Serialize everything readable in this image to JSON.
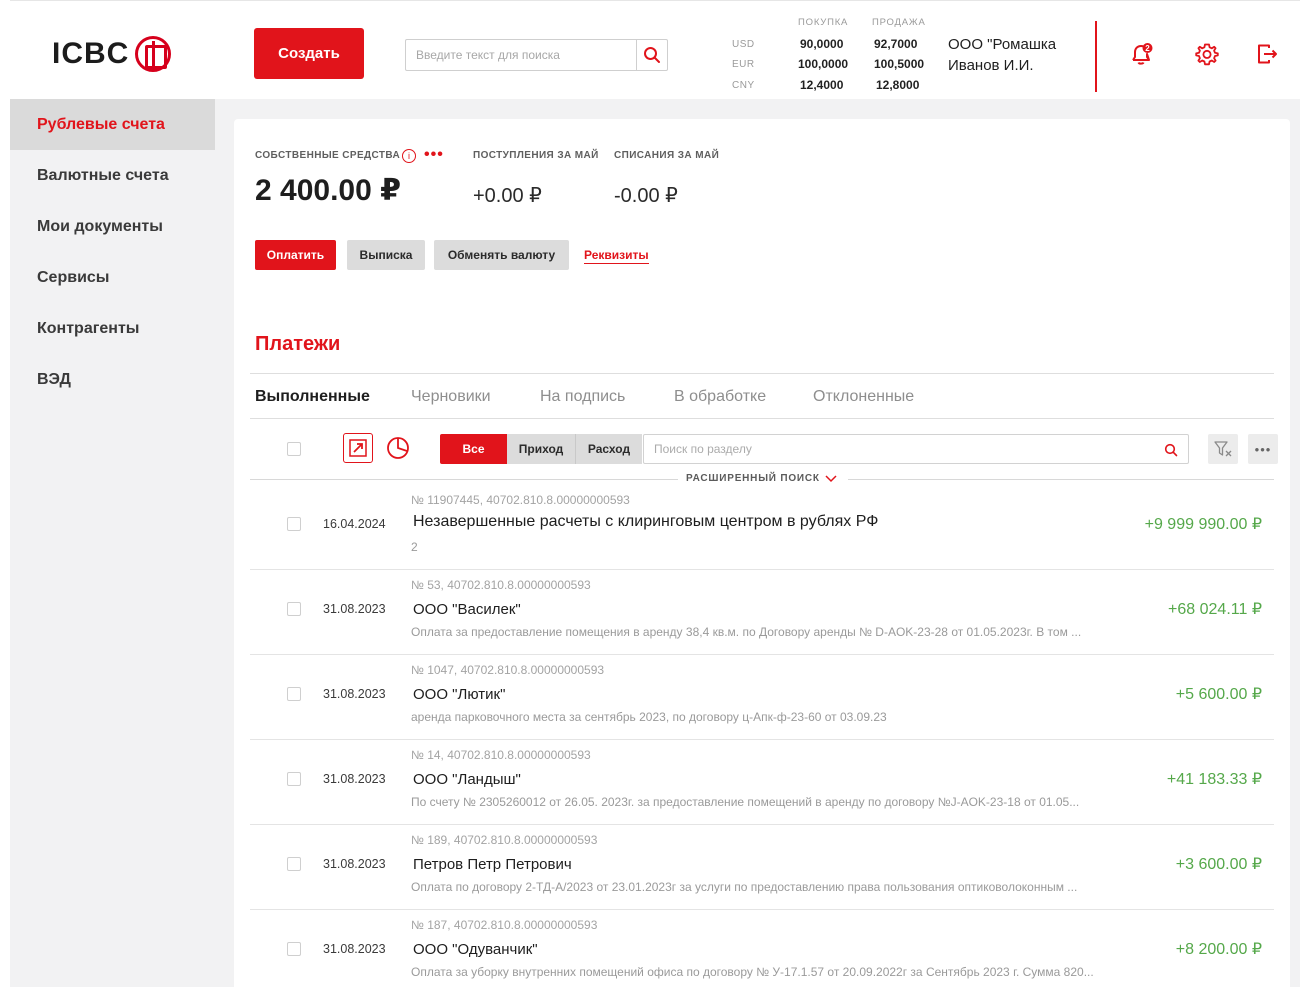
{
  "header": {
    "logo_text": "ICBC",
    "create_label": "Создать",
    "search_placeholder": "Введите текст для поиска",
    "rates": {
      "buy_header": "ПОКУПКА",
      "sell_header": "ПРОДАЖА",
      "rows": [
        {
          "currency": "USD",
          "buy": "90,0000",
          "sell": "92,7000"
        },
        {
          "currency": "EUR",
          "buy": "100,0000",
          "sell": "100,5000"
        },
        {
          "currency": "CNY",
          "buy": "12,4000",
          "sell": "12,8000"
        }
      ]
    },
    "company_name": "ООО \"Ромашка",
    "user_name": "Иванов И.И.",
    "notification_count": "2",
    "icons": [
      "bell-icon",
      "gear-icon",
      "logout-icon"
    ],
    "accent_color": "#e1141b"
  },
  "sidebar": {
    "items": [
      {
        "label": "Рублевые счета",
        "active": true
      },
      {
        "label": "Валютные счета",
        "active": false
      },
      {
        "label": "Мои документы",
        "active": false
      },
      {
        "label": "Сервисы",
        "active": false
      },
      {
        "label": "Контрагенты",
        "active": false
      },
      {
        "label": "ВЭД",
        "active": false
      }
    ]
  },
  "balance": {
    "own_funds_label": "СОБСТВЕННЫЕ СРЕДСТВА",
    "own_funds_value": "2 400.00 ₽",
    "income_label": "ПОСТУПЛЕНИЯ ЗА МАЙ",
    "income_value": "+0.00 ₽",
    "outgo_label": "СПИСАНИЯ ЗА МАЙ",
    "outgo_value": "-0.00 ₽",
    "info_icon_text": "i",
    "more_dots": "•••"
  },
  "actions": {
    "pay": "Оплатить",
    "statement": "Выписка",
    "exchange": "Обменять валюту",
    "requisites": "Реквизиты"
  },
  "payments": {
    "title": "Платежи",
    "tabs": [
      {
        "label": "Выполненные",
        "active": true
      },
      {
        "label": "Черновики",
        "active": false
      },
      {
        "label": "На подпись",
        "active": false
      },
      {
        "label": "В обработке",
        "active": false
      },
      {
        "label": "Отклоненные",
        "active": false
      }
    ],
    "filter": {
      "all": "Все",
      "income": "Приход",
      "outgo": "Расход",
      "search_placeholder": "Поиск по разделу",
      "advanced_search": "РАСШИРЕННЫЙ ПОИСК",
      "more_dots": "•••"
    },
    "rows": [
      {
        "date": "16.04.2024",
        "meta": "№ 11907445, 40702.810.8.00000000593",
        "name": "Незавершенные расчеты с клиринговым центром в рублях РФ",
        "desc": "2",
        "amount": "+9 999 990.00 ₽"
      },
      {
        "date": "31.08.2023",
        "meta": "№ 53, 40702.810.8.00000000593",
        "name": "ООО \"Василек\"",
        "desc": "Оплата за предоставление помещения в аренду 38,4 кв.м. по Договору аренды № D-AOK-23-28 от 01.05.2023г. В том ...",
        "amount": "+68 024.11 ₽"
      },
      {
        "date": "31.08.2023",
        "meta": "№ 1047, 40702.810.8.00000000593",
        "name": "ООО \"Лютик\"",
        "desc": "аренда парковочного места за сентябрь 2023, по договору ц-Апк-ф-23-60 от 03.09.23",
        "amount": "+5 600.00 ₽"
      },
      {
        "date": "31.08.2023",
        "meta": "№ 14, 40702.810.8.00000000593",
        "name": "ООО \"Ландыш\"",
        "desc": "По счету № 2305260012 от 26.05. 2023г. за предоставление помещений в аренду по договору №J-AOK-23-18 от 01.05...",
        "amount": "+41 183.33 ₽"
      },
      {
        "date": "31.08.2023",
        "meta": "№ 189, 40702.810.8.00000000593",
        "name": "Петров Петр Петрович",
        "desc": "Оплата по договору 2-ТД-А/2023 от 23.01.2023г за услуги по предоставлению права пользования оптиковолоконным ...",
        "amount": "+3 600.00 ₽"
      },
      {
        "date": "31.08.2023",
        "meta": "№ 187, 40702.810.8.00000000593",
        "name": "ООО \"Одуванчик\"",
        "desc": "Оплата за уборку внутренних помещений офиса по договору № У-17.1.57 от 20.09.2022г за Сентябрь 2023 г. Сумма 820...",
        "amount": "+8 200.00 ₽"
      }
    ]
  }
}
